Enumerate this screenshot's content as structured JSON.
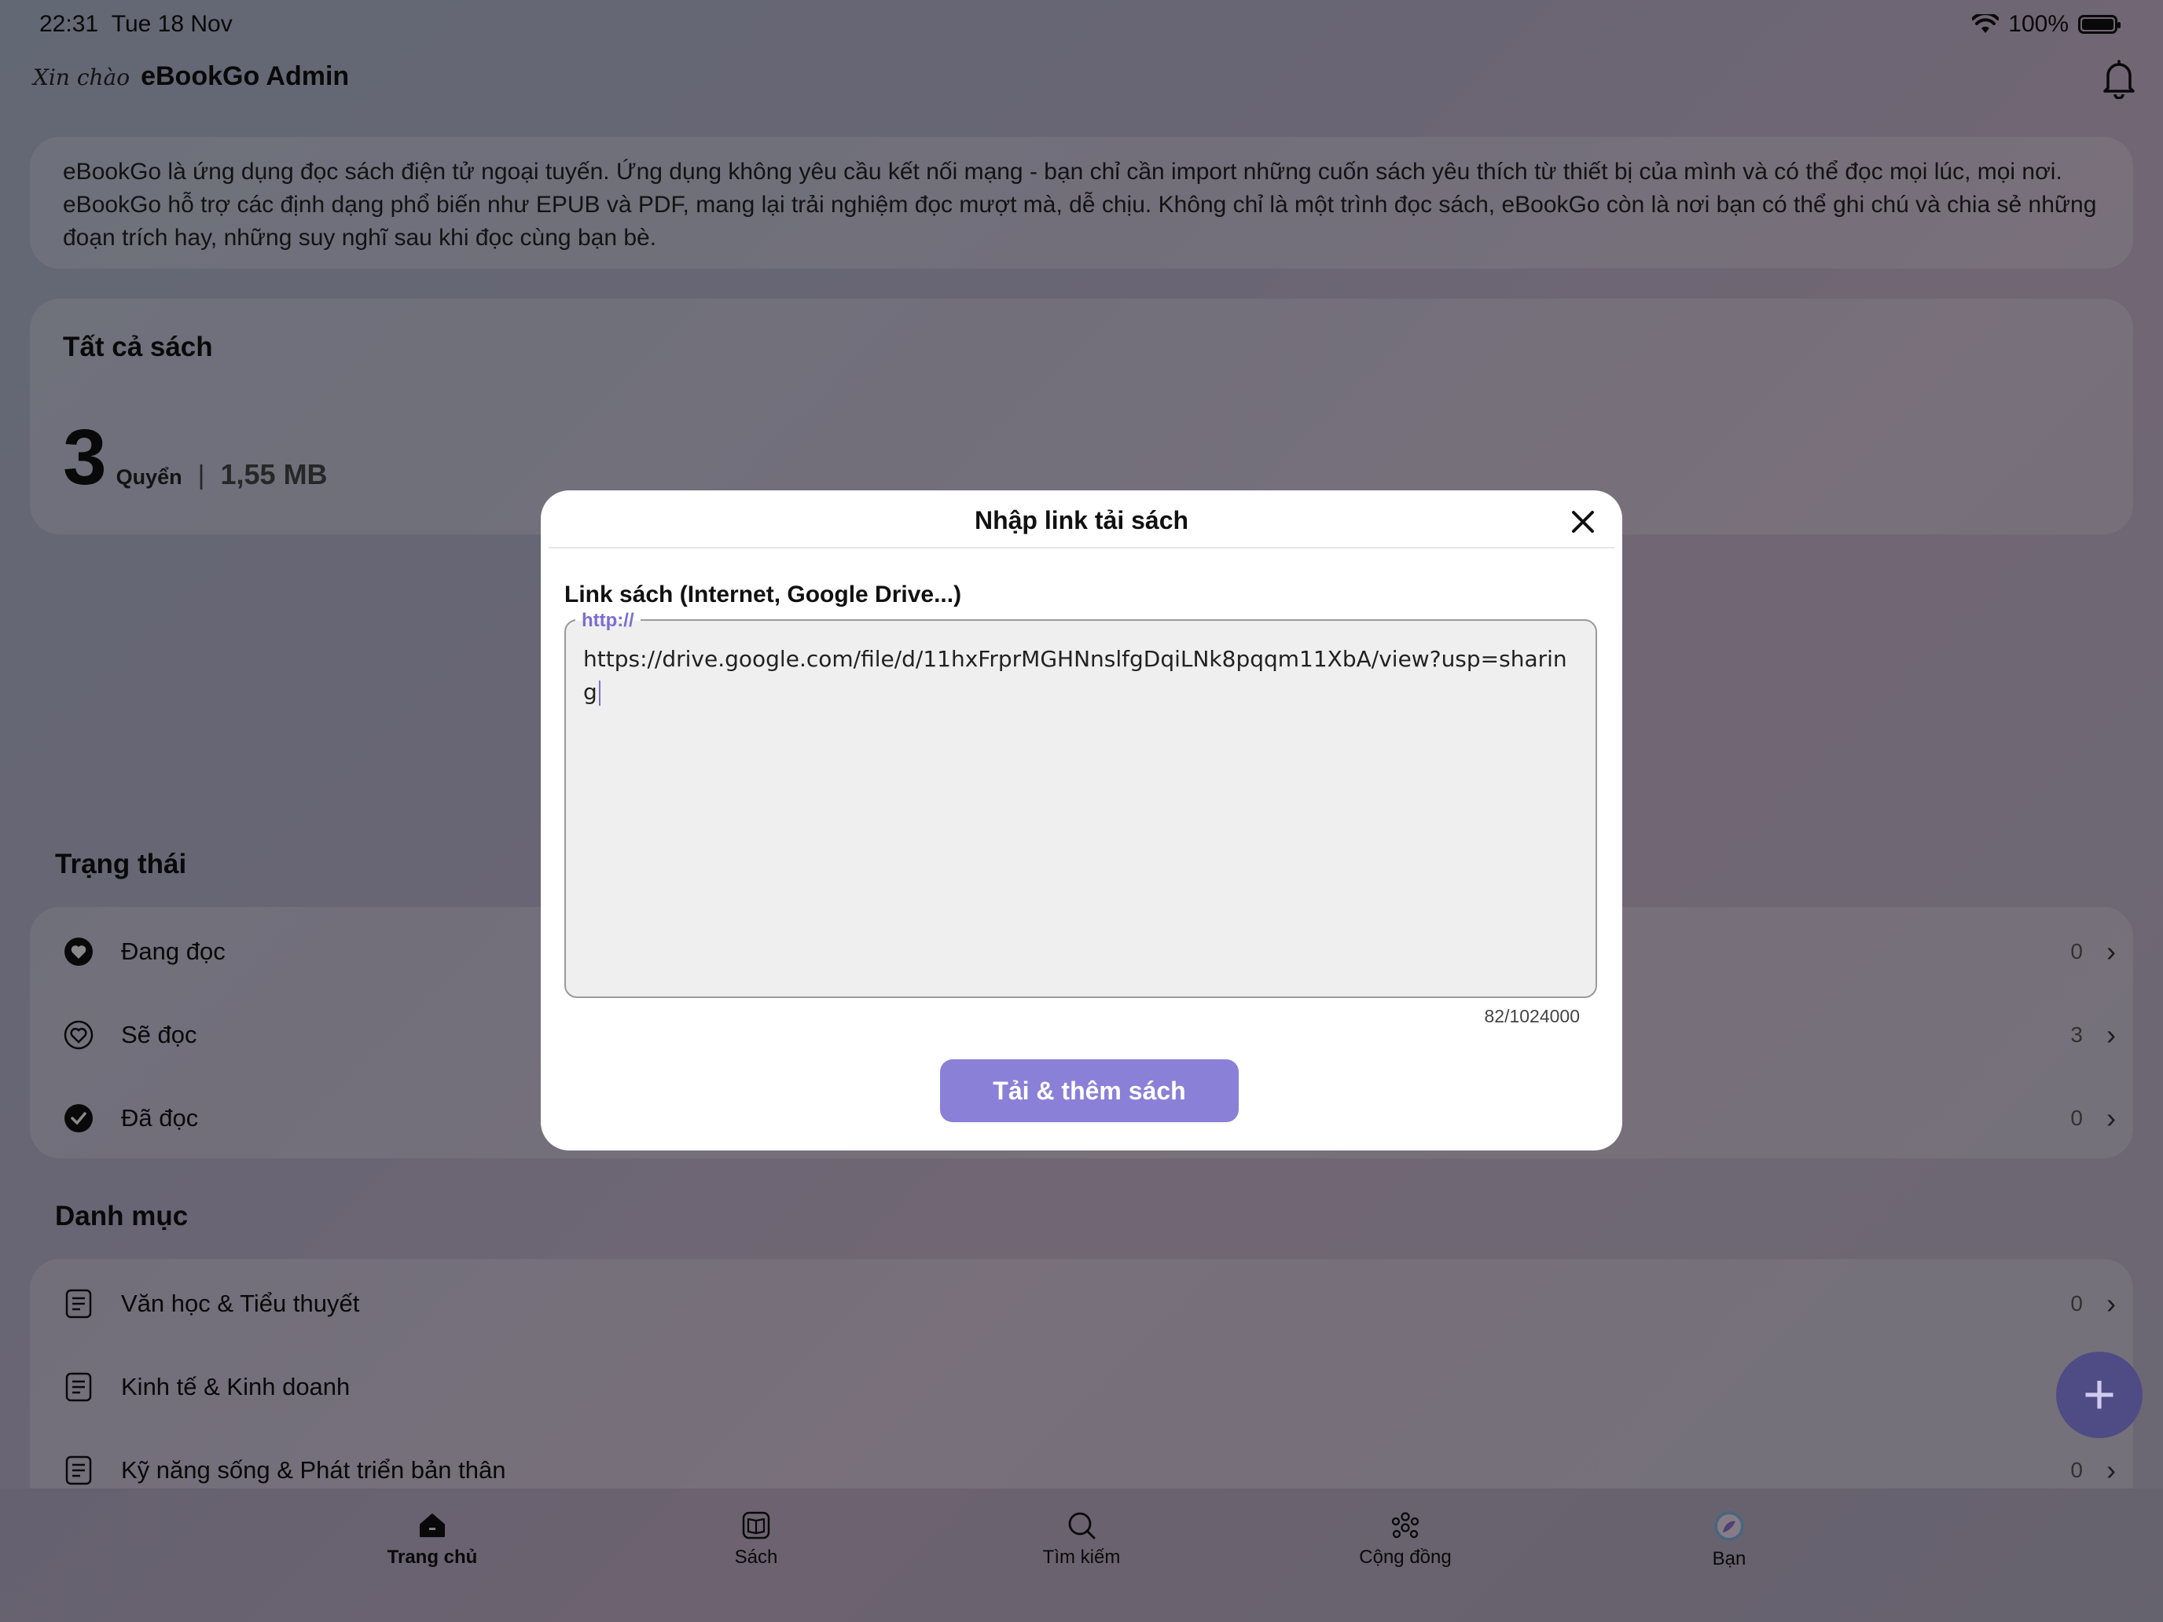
{
  "status_bar": {
    "time": "22:31",
    "date": "Tue 18 Nov",
    "battery": "100%"
  },
  "header": {
    "greeting": "Xin chào",
    "user": "eBookGo Admin"
  },
  "intro_text": "eBookGo là ứng dụng đọc sách điện tử ngoại tuyến. Ứng dụng không yêu cầu kết nối mạng - bạn chỉ cần import những cuốn sách yêu thích từ thiết bị của mình và có thể đọc mọi lúc, mọi nơi. eBookGo hỗ trợ các định dạng phổ biến như EPUB và PDF, mang lại trải nghiệm đọc mượt mà, dễ chịu. Không chỉ là một trình đọc sách, eBookGo còn là nơi bạn có thể ghi chú và chia sẻ những đoạn trích hay, những suy nghĩ sau khi đọc cùng bạn bè.",
  "all_books": {
    "title": "Tất cả sách",
    "count": "3",
    "unit": "Quyển",
    "separator": "|",
    "size": "1,55 MB"
  },
  "status_section": {
    "title": "Trạng thái",
    "items": [
      {
        "label": "Đang đọc",
        "count": "0",
        "icon": "heart-filled-icon"
      },
      {
        "label": "Sẽ đọc",
        "count": "3",
        "icon": "heart-outline-icon"
      },
      {
        "label": "Đã đọc",
        "count": "0",
        "icon": "check-circle-icon"
      }
    ]
  },
  "category_section": {
    "title": "Danh mục",
    "items": [
      {
        "label": "Văn học & Tiểu thuyết",
        "count": "0"
      },
      {
        "label": "Kinh tế & Kinh doanh",
        "count": ""
      },
      {
        "label": "Kỹ năng sống & Phát triển bản thân",
        "count": "0"
      }
    ]
  },
  "tabs": [
    {
      "label": "Trang chủ",
      "icon": "home-icon"
    },
    {
      "label": "Sách",
      "icon": "book-icon"
    },
    {
      "label": "Tìm kiếm",
      "icon": "search-icon"
    },
    {
      "label": "Cộng đồng",
      "icon": "community-icon"
    },
    {
      "label": "Bạn",
      "icon": "avatar-icon"
    }
  ],
  "fab": {
    "symbol": "+"
  },
  "dialog": {
    "title": "Nhập link tải sách",
    "field_label": "Link sách (Internet, Google Drive...)",
    "field_legend": "http://",
    "field_value": "https://drive.google.com/file/d/11hxFrprMGHNnslfgDqiLNk8pqqm11XbA/view?usp=sharing",
    "char_count": "82/1024000",
    "submit_label": "Tải & thêm sách"
  },
  "colors": {
    "accent": "#8b80d8",
    "fab": "#4f4b84",
    "legend": "#7a6fd0"
  }
}
